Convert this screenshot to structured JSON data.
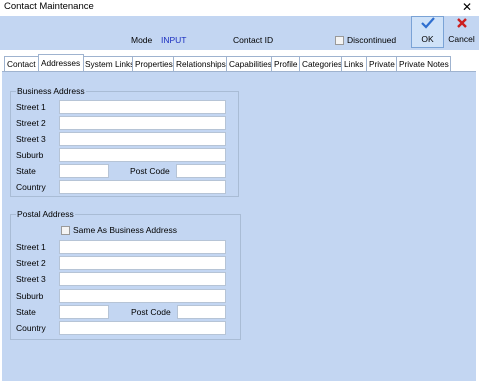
{
  "window": {
    "title": "Contact Maintenance"
  },
  "header": {
    "mode_label": "Mode",
    "mode_value": "INPUT",
    "contact_id_label": "Contact ID",
    "discontinued_label": "Discontinued",
    "ok_label": "OK",
    "cancel_label": "Cancel"
  },
  "icons": {
    "ok": "checkmark-icon",
    "cancel": "x-icon",
    "close": "close-icon"
  },
  "colors": {
    "panel": "#c3d6f2",
    "mode_value": "#1a2ec0",
    "ok_icon": "#2f6fcf",
    "cancel_icon": "#cc1f1f"
  },
  "tabs": [
    "Contact",
    "Addresses",
    "System Links",
    "Properties",
    "Relationships",
    "Capabilities",
    "Profile",
    "Categories",
    "Links",
    "Private",
    "Private Notes"
  ],
  "active_tab": "Addresses",
  "business": {
    "title": "Business Address",
    "street1": "Street 1",
    "street2": "Street 2",
    "street3": "Street 3",
    "suburb": "Suburb",
    "state": "State",
    "postcode": "Post Code",
    "country": "Country"
  },
  "postal": {
    "title": "Postal Address",
    "same_as": "Same As Business Address",
    "street1": "Street 1",
    "street2": "Street 2",
    "street3": "Street 3",
    "suburb": "Suburb",
    "state": "State",
    "postcode": "Post Code",
    "country": "Country"
  }
}
